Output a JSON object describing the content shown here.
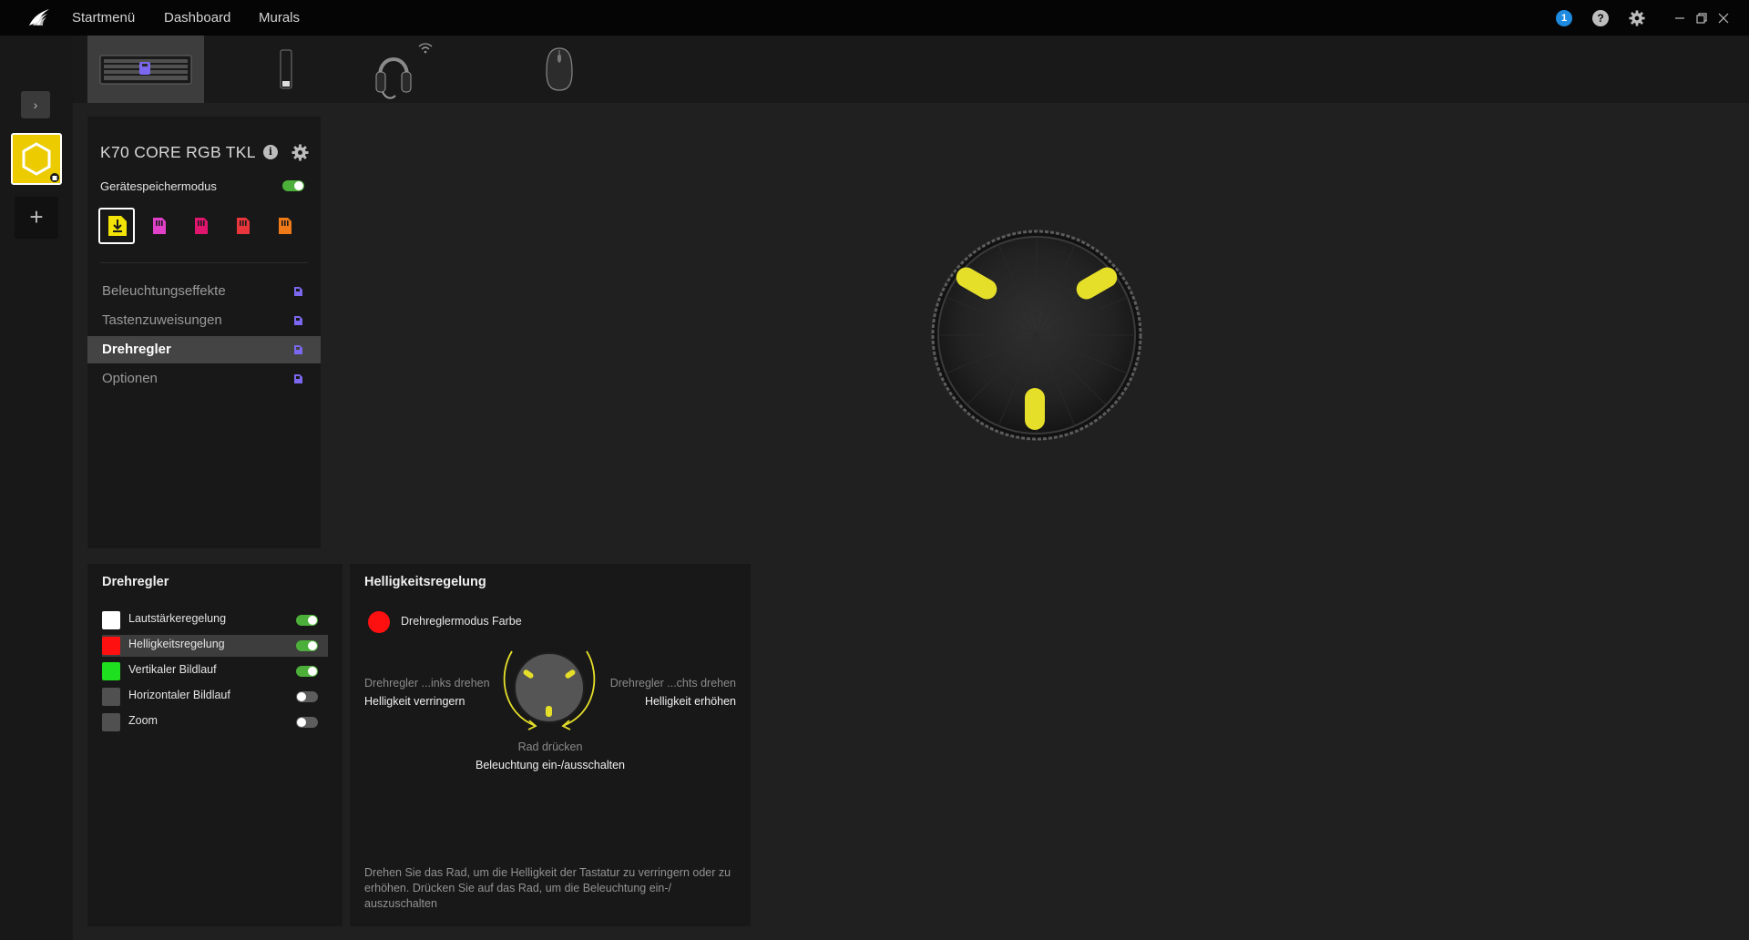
{
  "topbar": {
    "nav": [
      "Startmenü",
      "Dashboard",
      "Murals"
    ],
    "notification_count": "1",
    "help_symbol": "?",
    "icons": [
      "corsair-logo-icon",
      "notification-icon",
      "help-icon",
      "gear-icon",
      "minimize-icon",
      "restore-icon",
      "close-icon"
    ]
  },
  "rail": {
    "expand_symbol": "›",
    "add_symbol": "+"
  },
  "devices": [
    "keyboard",
    "usb-receiver",
    "headset",
    "mouse"
  ],
  "profile": {
    "device_name": "K70 CORE RGB TKL",
    "info_symbol": "i",
    "memory_mode_label": "Gerätespeichermodus",
    "memory_mode_on": true,
    "slot_colors": [
      "#f2e205",
      "#e040c8",
      "#e0156e",
      "#e8363c",
      "#f07a18"
    ],
    "menu": [
      {
        "label": "Beleuchtungseffekte",
        "active": false
      },
      {
        "label": "Tastenzuweisungen",
        "active": false
      },
      {
        "label": "Drehregler",
        "active": true
      },
      {
        "label": "Optionen",
        "active": false
      }
    ]
  },
  "dial_list": {
    "title": "Drehregler",
    "rows": [
      {
        "label": "Lautstärkeregelung",
        "color": "#ffffff",
        "on": true,
        "selected": false
      },
      {
        "label": "Helligkeitsregelung",
        "color": "#ff1010",
        "on": true,
        "selected": true
      },
      {
        "label": "Vertikaler Bildlauf",
        "color": "#1ee01e",
        "on": true,
        "selected": false
      },
      {
        "label": "Horizontaler Bildlauf",
        "color": "#505050",
        "on": false,
        "selected": false
      },
      {
        "label": "Zoom",
        "color": "#505050",
        "on": false,
        "selected": false
      }
    ]
  },
  "detail": {
    "title": "Helligkeitsregelung",
    "color_mode_label": "Drehreglermodus Farbe",
    "color": "#ff1010",
    "left_caption": "Drehregler ...inks drehen",
    "left_action": "Helligkeit verringern",
    "right_caption": "Drehregler ...chts drehen",
    "right_action": "Helligkeit erhöhen",
    "press_caption": "Rad drücken",
    "press_action": "Beleuchtung ein-/ausschalten",
    "description": "Drehen Sie das Rad, um die Helligkeit der Tastatur zu verringern oder zu erhöhen. Drücken Sie auf das Rad, um die Beleuchtung ein-/ auszuschalten"
  },
  "colors": {
    "accent_yellow": "#eccb00",
    "toggle_on": "#4caf3a",
    "memory_icon": "#7a68f0"
  }
}
